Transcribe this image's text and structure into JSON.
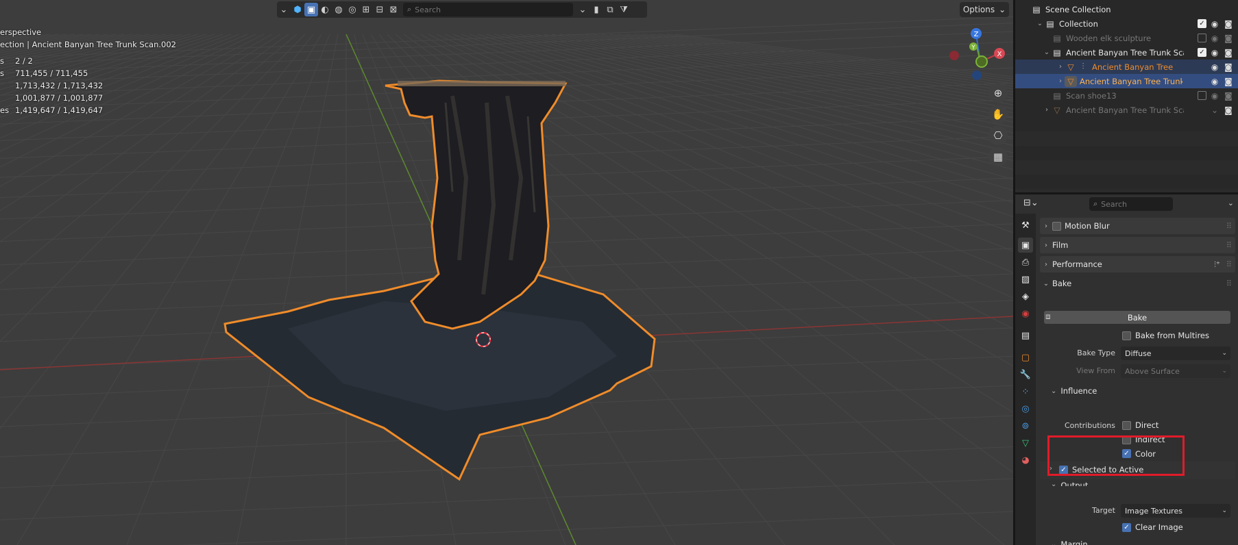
{
  "viewport": {
    "search_placeholder": "Search",
    "options_label": "Options",
    "stats": [
      {
        "key": "",
        "value": "erspective"
      },
      {
        "key": "",
        "value": "ection | Ancient Banyan Tree Trunk Scan.002"
      },
      {
        "key": "s",
        "value": "2 / 2"
      },
      {
        "key": "s",
        "value": "711,455 / 711,455"
      },
      {
        "key": "",
        "value": "1,713,432 / 1,713,432"
      },
      {
        "key": "",
        "value": "1,001,877 / 1,001,877"
      },
      {
        "key": "es",
        "value": "1,419,647 / 1,419,647"
      }
    ],
    "gizmo": {
      "z": "Z",
      "y": "Y",
      "x": "X"
    }
  },
  "outliner": {
    "rows": [
      {
        "label": "Scene Collection",
        "state": "normal"
      },
      {
        "label": "Collection",
        "state": "normal"
      },
      {
        "label": "Wooden elk sculpture",
        "state": "disabled"
      },
      {
        "label": "Ancient Banyan Tree Trunk Sca",
        "state": "normal"
      },
      {
        "label": "Ancient Banyan Tree T",
        "state": "selected-orange"
      },
      {
        "label": "Ancient Banyan Tree Trunk",
        "state": "active"
      },
      {
        "label": "Scan shoe13",
        "state": "disabled"
      },
      {
        "label": "Ancient Banyan Tree Trunk Sca",
        "state": "disabled"
      }
    ]
  },
  "properties": {
    "search_placeholder": "Search",
    "panels": {
      "motion_blur": "Motion Blur",
      "film": "Film",
      "performance": "Performance",
      "bake": "Bake"
    },
    "bake_button": "Bake",
    "bake_from_multires": "Bake from Multires",
    "bake_type_label": "Bake Type",
    "bake_type_value": "Diffuse",
    "view_from_label": "View From",
    "view_from_value": "Above Surface",
    "influence": "Influence",
    "contributions_label": "Contributions",
    "direct": "Direct",
    "indirect": "Indirect",
    "color": "Color",
    "selected_to_active": "Selected to Active",
    "output": "Output",
    "target_label": "Target",
    "target_value": "Image Textures",
    "clear_image": "Clear Image",
    "margin": "Margin"
  },
  "colors": {
    "selection_orange": "#f08c2a",
    "highlight_red": "#e11b2a",
    "active_blue": "#4772b3"
  }
}
